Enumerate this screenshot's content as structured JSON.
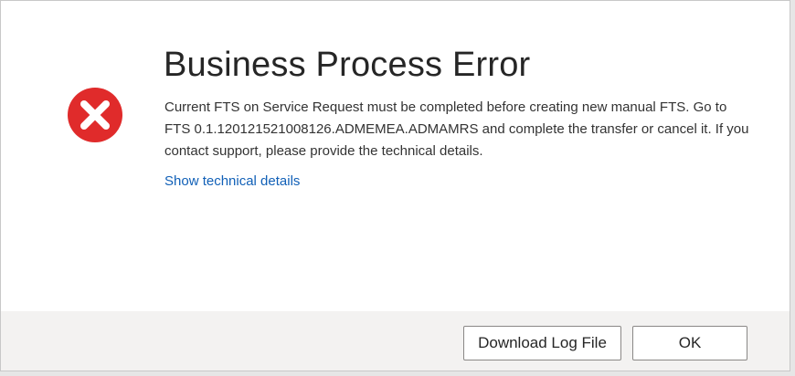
{
  "dialog": {
    "icon": "error-x-icon",
    "title": "Business Process Error",
    "message": "Current FTS on Service Request must be completed before creating new manual FTS. Go to FTS 0.1.120121521008126.ADMEMEA.ADMAMRS and complete the transfer or cancel it. If you contact support, please provide the technical details.",
    "details_link": "Show technical details"
  },
  "footer": {
    "download_label": "Download Log File",
    "ok_label": "OK"
  },
  "colors": {
    "error_red": "#e02b2b",
    "link_blue": "#1160b7",
    "footer_bg": "#f3f2f1"
  }
}
